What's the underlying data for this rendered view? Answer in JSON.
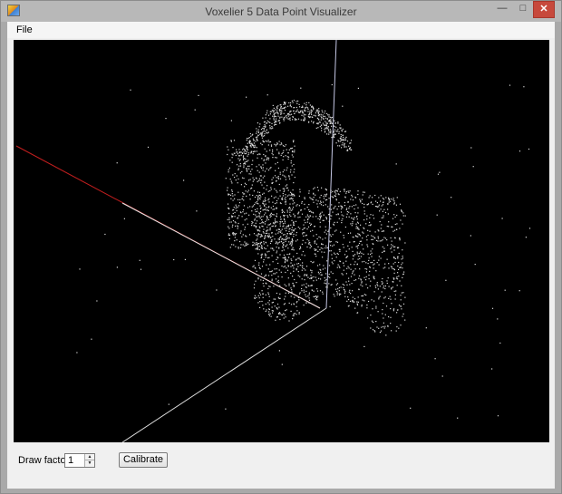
{
  "window": {
    "title": "Voxelier 5 Data Point Visualizer",
    "minimize_glyph": "—",
    "maximize_glyph": "□",
    "close_glyph": "✕"
  },
  "menu": {
    "items": [
      {
        "label": "File"
      }
    ]
  },
  "controls": {
    "draw_factor_label": "Draw factor:",
    "draw_factor_value": "1",
    "calibrate_label": "Calibrate"
  },
  "colors": {
    "viewport_background": "#000000",
    "axis_x": "#c21e1e",
    "axis_y": "#c6c8e6",
    "axis_z": "#e0e0e0",
    "points": "#d8d8d8"
  },
  "icons": {
    "app": "app-icon",
    "minimize": "minimize-icon",
    "maximize": "maximize-icon",
    "close": "close-icon"
  }
}
